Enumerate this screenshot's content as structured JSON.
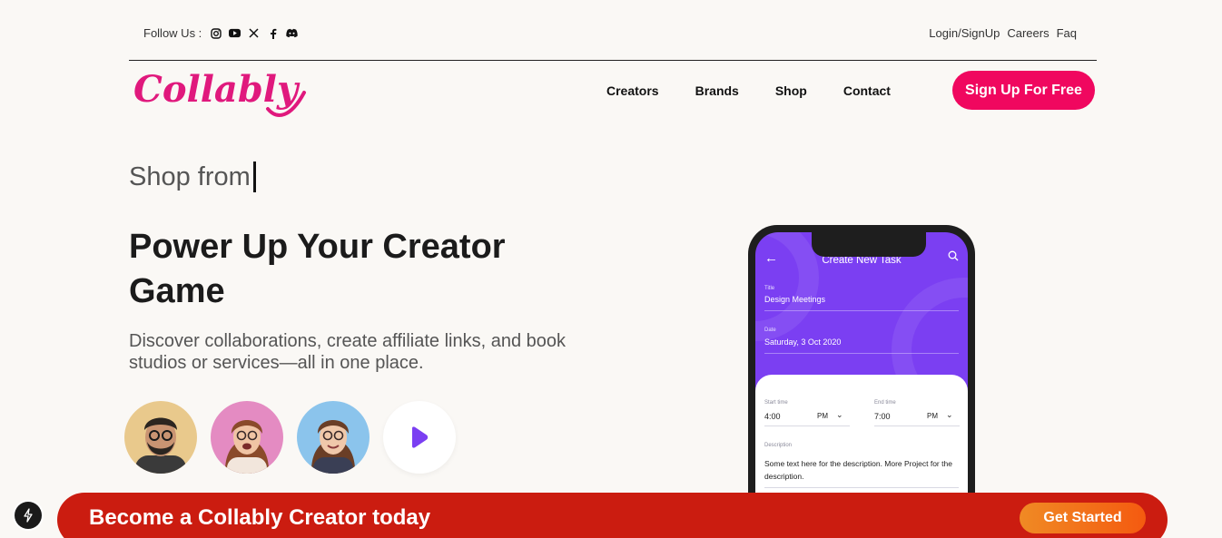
{
  "topbar": {
    "follow_label": "Follow Us :",
    "social_icons": [
      "instagram-icon",
      "youtube-icon",
      "x-icon",
      "facebook-icon",
      "discord-icon"
    ],
    "links": [
      "Login/SignUp",
      "Careers",
      "Faq"
    ]
  },
  "logo": {
    "text": "Collably",
    "color": "#e0197d"
  },
  "nav": {
    "items": [
      "Creators",
      "Brands",
      "Shop",
      "Contact"
    ]
  },
  "signup_button": {
    "label": "Sign Up For Free",
    "color": "#f0075f"
  },
  "hero": {
    "typed_text": "Shop from",
    "headline": "Power Up Your Creator Game",
    "subtitle": "Discover collaborations, create affiliate links, and book studios or services—all in one place."
  },
  "phone": {
    "header_title": "Create New Task",
    "title_label": "Title",
    "title_value": "Design Meetings",
    "date_label": "Date",
    "date_value": "Saturday, 3 Oct 2020",
    "start_label": "Start time",
    "start_value": "4:00",
    "start_period": "PM",
    "end_label": "End time",
    "end_value": "7:00",
    "end_period": "PM",
    "desc_label": "Description",
    "desc_value": "Some text here for the description. More Project for the description.",
    "accent": "#7b3ff2"
  },
  "banner": {
    "text": "Become a Collably Creator today",
    "button_label": "Get Started",
    "color": "#cb1c10"
  }
}
